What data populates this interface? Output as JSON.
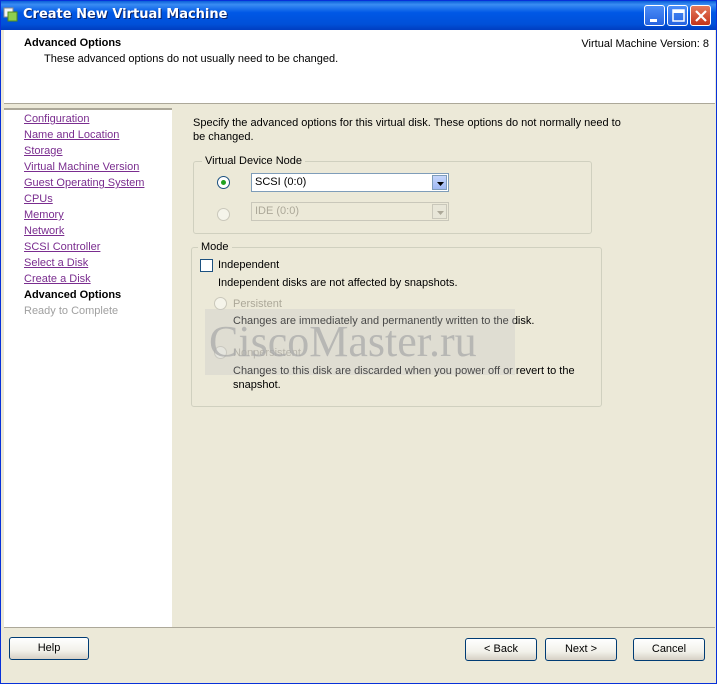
{
  "window": {
    "title": "Create New Virtual Machine"
  },
  "header": {
    "title": "Advanced Options",
    "subtitle": "These advanced options do not usually need to be changed.",
    "version": "Virtual Machine Version: 8"
  },
  "sidebar": {
    "items": [
      {
        "label": "Configuration",
        "state": "link"
      },
      {
        "label": "Name and Location",
        "state": "link"
      },
      {
        "label": "Storage",
        "state": "link"
      },
      {
        "label": "Virtual Machine Version",
        "state": "link"
      },
      {
        "label": "Guest Operating System",
        "state": "link"
      },
      {
        "label": "CPUs",
        "state": "link"
      },
      {
        "label": "Memory",
        "state": "link"
      },
      {
        "label": "Network",
        "state": "link"
      },
      {
        "label": "SCSI Controller",
        "state": "link"
      },
      {
        "label": "Select a Disk",
        "state": "link"
      },
      {
        "label": "Create a Disk",
        "state": "link"
      },
      {
        "label": "Advanced Options",
        "state": "current"
      },
      {
        "label": "Ready to Complete",
        "state": "disabled"
      }
    ]
  },
  "main": {
    "intro": "Specify the advanced options for this virtual disk. These options do not normally need to be changed.",
    "device_node": {
      "legend": "Virtual Device Node",
      "scsi_value": "SCSI (0:0)",
      "ide_value": "IDE (0:0)"
    },
    "mode": {
      "legend": "Mode",
      "independent_label": "Independent",
      "independent_desc": "Independent disks are not affected by snapshots.",
      "persistent_label": "Persistent",
      "persistent_desc": "Changes are immediately and permanently written to the disk.",
      "nonpersistent_label": "Nonpersistent",
      "nonpersistent_desc_1": "Changes to this disk are discarded when you power off or revert to the",
      "nonpersistent_desc_2": "snapshot."
    }
  },
  "watermark": "CiscoMaster.ru",
  "footer": {
    "help": "Help",
    "back": "< Back",
    "next": "Next >",
    "cancel": "Cancel"
  }
}
